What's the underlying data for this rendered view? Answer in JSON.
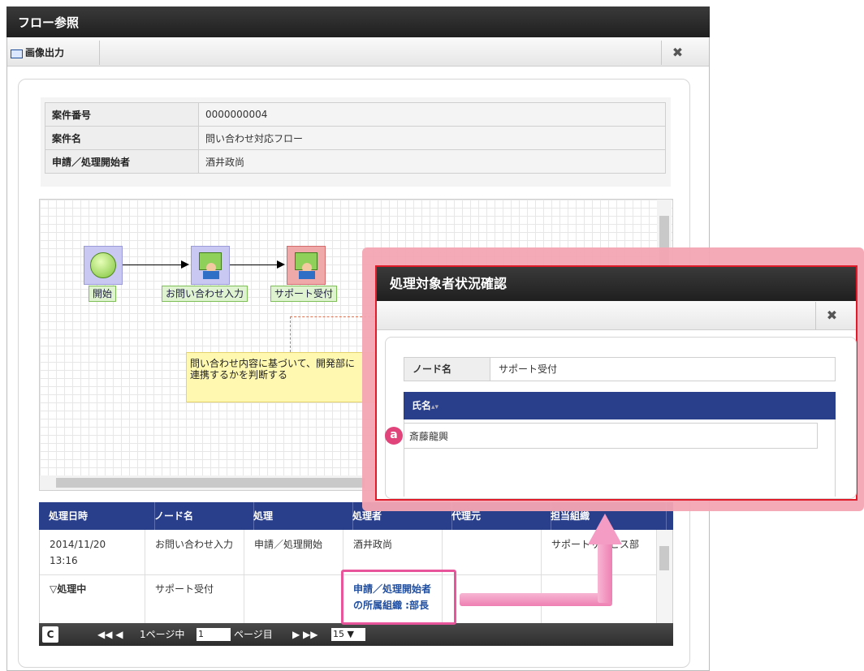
{
  "dialog": {
    "title": "フロー参照",
    "export_label": "画像出力",
    "close_glyph": "✖"
  },
  "info": [
    {
      "label": "案件番号",
      "value": "0000000004"
    },
    {
      "label": "案件名",
      "value": "問い合わせ対応フロー"
    },
    {
      "label": "申請／処理開始者",
      "value": "酒井政尚"
    }
  ],
  "diagram": {
    "nodes": [
      {
        "label": "開始",
        "type": "start"
      },
      {
        "label": "お問い合わせ入力",
        "type": "user-task"
      },
      {
        "label": "サポート受付",
        "type": "user-task-active"
      }
    ],
    "note": "問い合わせ内容に基づいて、開発部に\n連携するかを判断する"
  },
  "history": {
    "columns": [
      "処理日時",
      "ノード名",
      "処理",
      "処理者",
      "代理元",
      "担当組織"
    ],
    "rows": [
      {
        "date": "2014/11/20\n13:16",
        "node": "お問い合わせ入力",
        "action": "申請／処理開始",
        "actor": "酒井政尚",
        "proxy": "",
        "org": "サポートサービス部"
      },
      {
        "date": "▽処理中",
        "node": "サポート受付",
        "action": "",
        "actor": "申請／処理開始者の所属組織 :部長",
        "proxy": "",
        "org": ""
      }
    ]
  },
  "pager": {
    "refresh": "C",
    "nav_prev": "◀◀ ◀",
    "page_prefix": "1ページ中",
    "page": "1",
    "page_suffix": "ページ目",
    "nav_next": "▶ ▶▶",
    "size": "15 ▼"
  },
  "popup": {
    "title": "処理対象者状況確認",
    "node_label": "ノード名",
    "node_value": "サポート受付",
    "column": "氏名",
    "sort_glyph": "▴▾",
    "rows": [
      "斎藤龍興"
    ],
    "badge": "a"
  },
  "colors": {
    "header_bg": "#2a3f8c",
    "callout": "#ee7fb2",
    "popup_border": "#e01b2a",
    "badge": "#e0447a"
  }
}
